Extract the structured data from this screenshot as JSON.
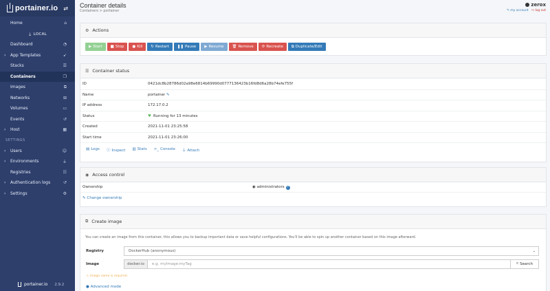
{
  "sidebar": {
    "brand": "portainer.io",
    "home": "Home",
    "env_label": "LOCAL",
    "items": [
      {
        "label": "Dashboard",
        "icon": "tachometer-icon"
      },
      {
        "label": "App Templates",
        "icon": "rocket-icon",
        "chevron": true
      },
      {
        "label": "Stacks",
        "icon": "th-list-icon"
      },
      {
        "label": "Containers",
        "icon": "cubes-icon",
        "active": true
      },
      {
        "label": "Images",
        "icon": "clone-icon"
      },
      {
        "label": "Networks",
        "icon": "sitemap-icon"
      },
      {
        "label": "Volumes",
        "icon": "hdd-icon"
      },
      {
        "label": "Events",
        "icon": "history-icon"
      },
      {
        "label": "Host",
        "icon": "th-icon",
        "chevron": true
      }
    ],
    "settings_title": "SETTINGS",
    "settings_items": [
      {
        "label": "Users",
        "icon": "users-icon",
        "chevron": true
      },
      {
        "label": "Environments",
        "icon": "plug-icon",
        "chevron": true
      },
      {
        "label": "Registries",
        "icon": "database-icon"
      },
      {
        "label": "Authentication logs",
        "icon": "history-icon",
        "chevron": true
      },
      {
        "label": "Settings",
        "icon": "cogs-icon",
        "chevron": true
      }
    ],
    "footer_brand": "portainer.io",
    "version": "2.9.2"
  },
  "header": {
    "title": "Container details",
    "breadcrumb": "Containers > portainer",
    "user": "zerox",
    "my_account": "my account",
    "logout": "log out"
  },
  "actions": {
    "title": "Actions",
    "start": "Start",
    "stop": "Stop",
    "kill": "Kill",
    "restart": "Restart",
    "pause": "Pause",
    "resume": "Resume",
    "remove": "Remove",
    "recreate": "Recreate",
    "duplicate": "Duplicate/Edit"
  },
  "status": {
    "title": "Container status",
    "rows": [
      {
        "key": "ID",
        "value": "0421dc8b28786d02a98e6814b69990d0777136423b16fd8d6a28b74efe755f"
      },
      {
        "key": "Name",
        "value": "portainer"
      },
      {
        "key": "IP address",
        "value": "172.17.0.2"
      },
      {
        "key": "Status",
        "value": "Running for 13 minutes"
      },
      {
        "key": "Created",
        "value": "2021-11-01 23:25:58"
      },
      {
        "key": "Start time",
        "value": "2021-11-01 23:26:00"
      }
    ],
    "links": {
      "logs": "Logs",
      "inspect": "Inspect",
      "stats": "Stats",
      "console": "Console",
      "attach": "Attach"
    }
  },
  "access": {
    "title": "Access control",
    "ownership_label": "Ownership",
    "ownership_value": "administrators",
    "change": "Change ownership"
  },
  "create_image": {
    "title": "Create image",
    "description": "You can create an image from this container, this allows you to backup important data or save helpful configurations. You'll be able to spin up another container based on this image afterward.",
    "registry_label": "Registry",
    "registry_value": "DockerHub (anonymous)",
    "image_label": "Image",
    "image_prefix": "docker.io",
    "image_placeholder": "e.g. myImage:myTag",
    "search": "Search",
    "warning": "Image name is required.",
    "advanced": "Advanced mode"
  }
}
